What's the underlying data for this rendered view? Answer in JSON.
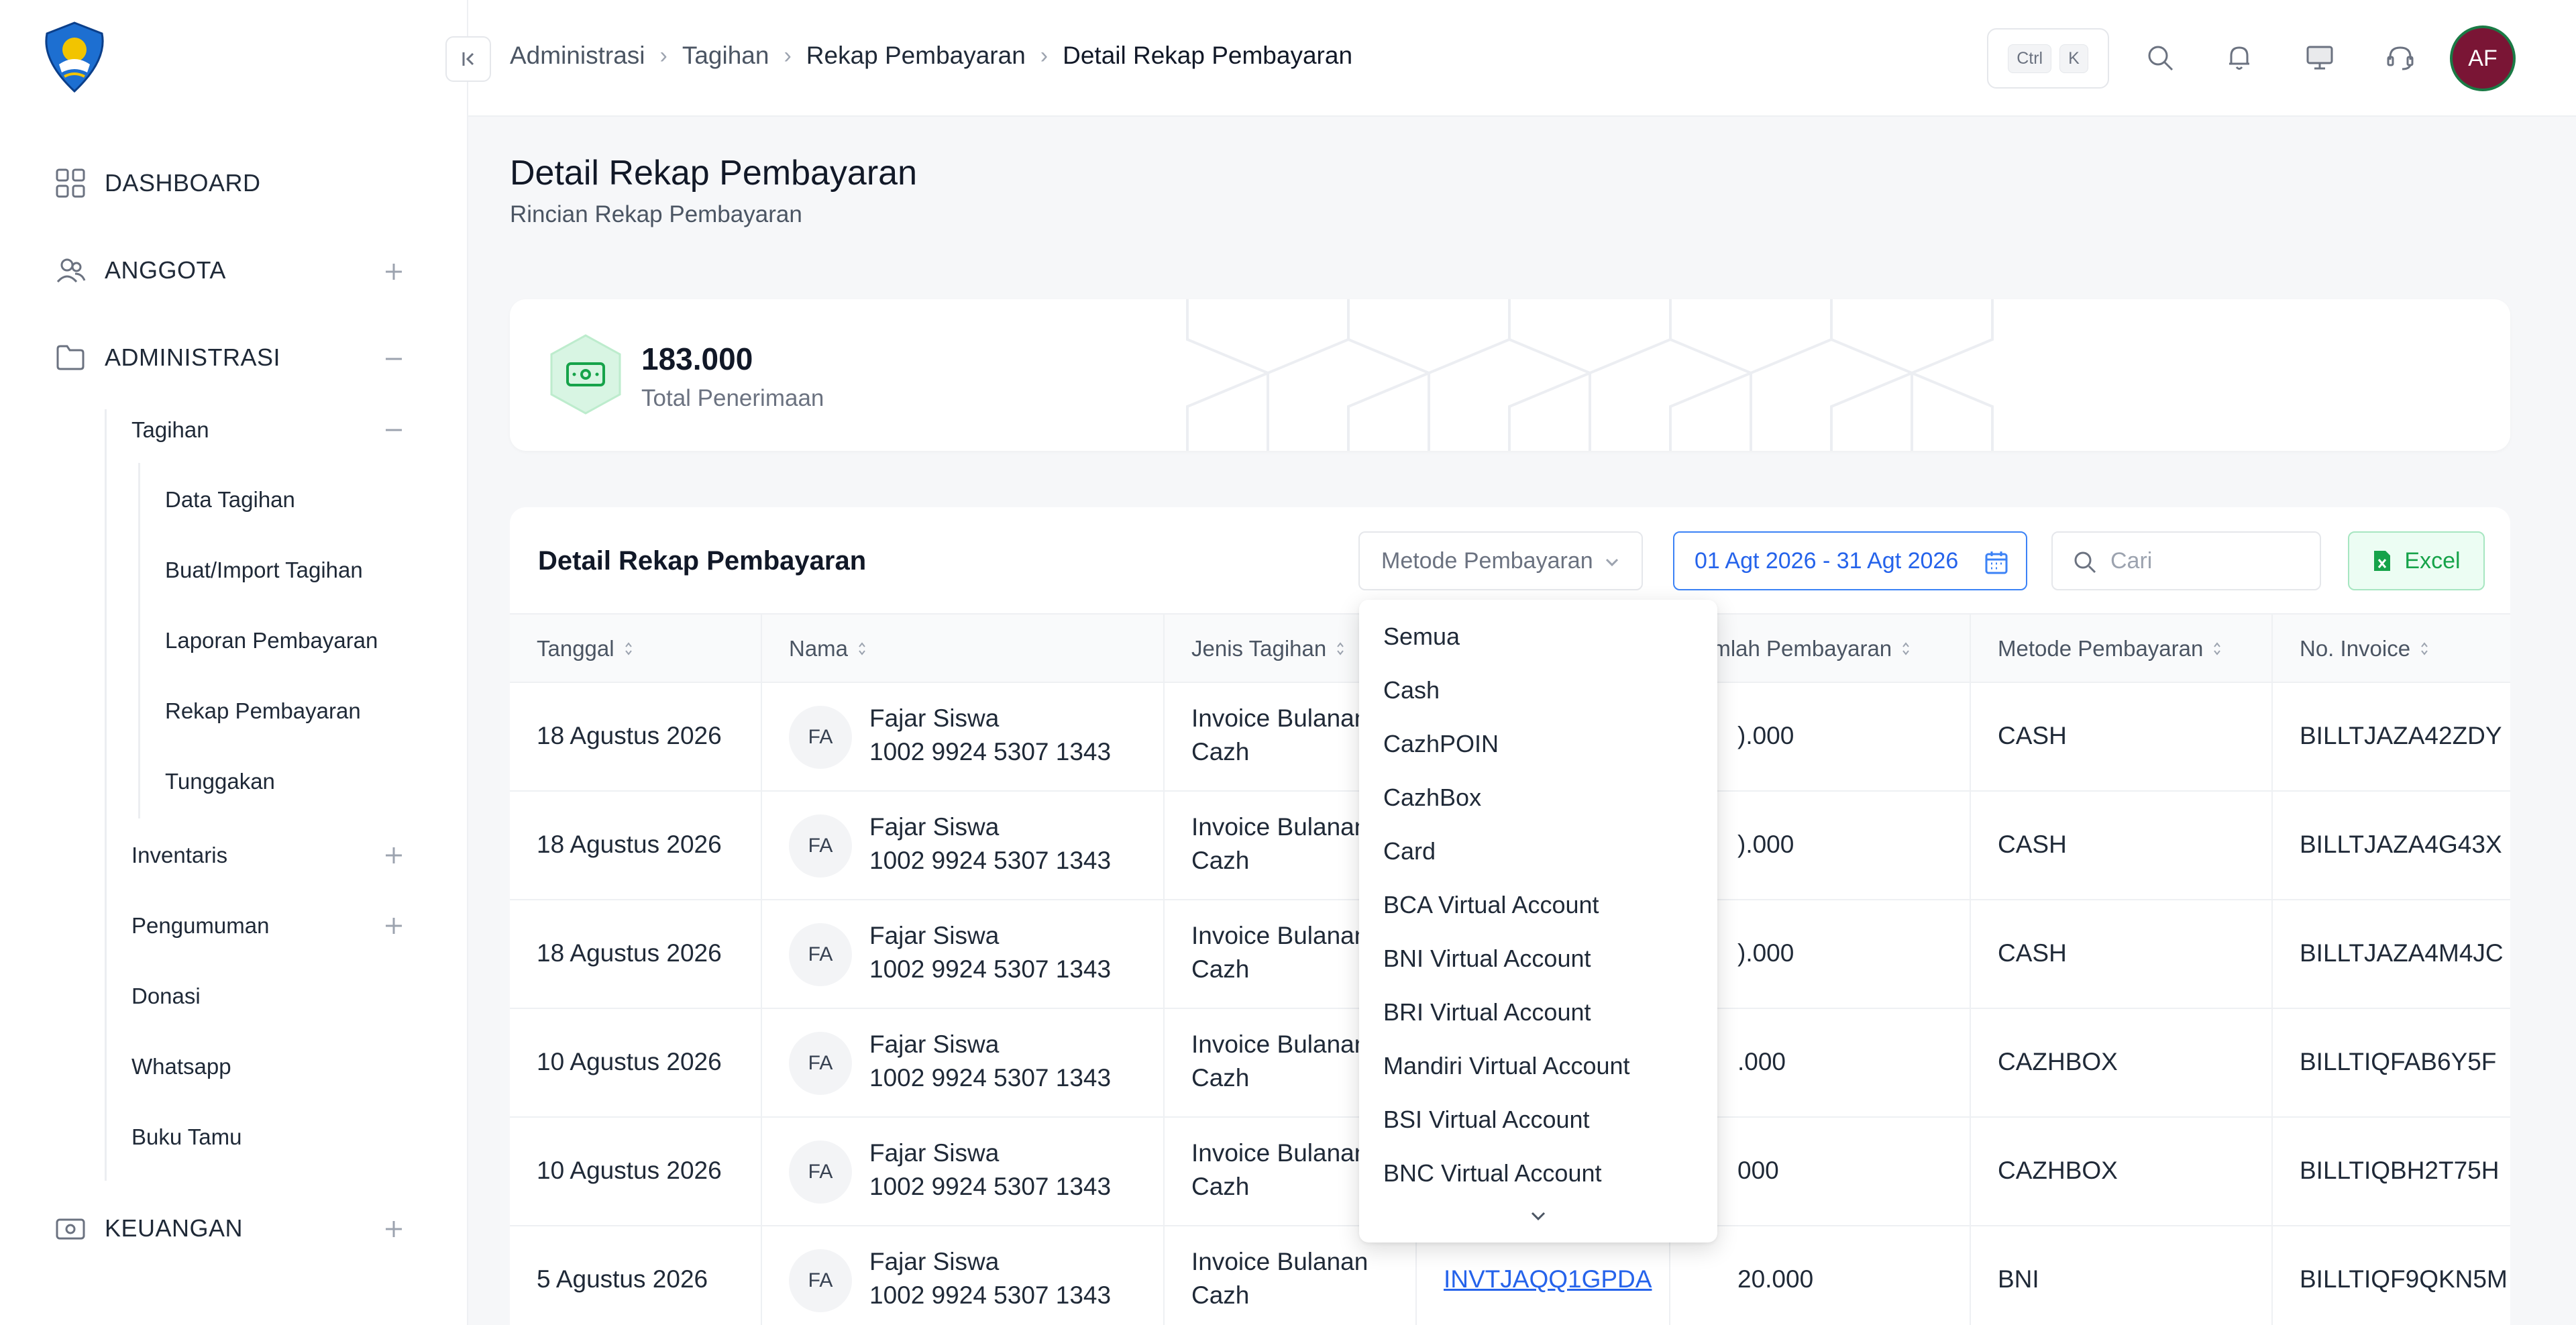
{
  "sidebar": {
    "menu": [
      {
        "label": "DASHBOARD",
        "icon": "grid-icon"
      },
      {
        "label": "ANGGOTA",
        "icon": "users-icon"
      },
      {
        "label": "ADMINISTRASI",
        "icon": "folder-icon"
      },
      {
        "label": "KEUANGAN",
        "icon": "cash-icon"
      }
    ],
    "admin_sub": [
      {
        "label": "Tagihan"
      },
      {
        "label": "Inventaris"
      },
      {
        "label": "Pengumuman"
      },
      {
        "label": "Donasi"
      },
      {
        "label": "Whatsapp"
      },
      {
        "label": "Buku Tamu"
      }
    ],
    "tagihan_sub": [
      {
        "label": "Data Tagihan"
      },
      {
        "label": "Buat/Import Tagihan"
      },
      {
        "label": "Laporan Pembayaran"
      },
      {
        "label": "Rekap Pembayaran"
      },
      {
        "label": "Tunggakan"
      }
    ]
  },
  "breadcrumb": [
    "Administrasi",
    "Tagihan",
    "Rekap Pembayaran",
    "Detail Rekap Pembayaran"
  ],
  "topbar": {
    "kbd_ctrl": "Ctrl",
    "kbd_k": "K",
    "avatar_initials": "AF"
  },
  "page": {
    "title": "Detail Rekap Pembayaran",
    "subtitle": "Rincian Rekap Pembayaran"
  },
  "summary": {
    "value": "183.000",
    "label": "Total Penerimaan"
  },
  "table": {
    "title": "Detail Rekap Pembayaran",
    "filter_placeholder": "Metode Pembayaran",
    "date_range": "01 Agt 2026 - 31 Agt 2026",
    "search_placeholder": "Cari",
    "excel_label": "Excel",
    "headers": [
      "Tanggal",
      "Nama",
      "Jenis Tagihan",
      "umlah Pembayaran",
      "Metode Pembayaran",
      "No. Invoice"
    ],
    "rows": [
      {
        "date": "18 Agustus 2026",
        "initials": "FA",
        "name": "Fajar Siswa",
        "number": "1002 9924 5307 1343",
        "jenis1": "Invoice Bulanan",
        "jenis2": "Cazh",
        "invoice_link": "",
        "amount": ").000",
        "method": "CASH",
        "invoice": "BILLTJAZA42ZDY"
      },
      {
        "date": "18 Agustus 2026",
        "initials": "FA",
        "name": "Fajar Siswa",
        "number": "1002 9924 5307 1343",
        "jenis1": "Invoice Bulanan",
        "jenis2": "Cazh",
        "invoice_link": "",
        "amount": ").000",
        "method": "CASH",
        "invoice": "BILLTJAZA4G43X"
      },
      {
        "date": "18 Agustus 2026",
        "initials": "FA",
        "name": "Fajar Siswa",
        "number": "1002 9924 5307 1343",
        "jenis1": "Invoice Bulanan",
        "jenis2": "Cazh",
        "invoice_link": "",
        "amount": ").000",
        "method": "CASH",
        "invoice": "BILLTJAZA4M4JC"
      },
      {
        "date": "10 Agustus 2026",
        "initials": "FA",
        "name": "Fajar Siswa",
        "number": "1002 9924 5307 1343",
        "jenis1": "Invoice Bulanan",
        "jenis2": "Cazh",
        "invoice_link": "",
        "amount": ".000",
        "method": "CAZHBOX",
        "invoice": "BILLTIQFAB6Y5F"
      },
      {
        "date": "10 Agustus 2026",
        "initials": "FA",
        "name": "Fajar Siswa",
        "number": "1002 9924 5307 1343",
        "jenis1": "Invoice Bulanan",
        "jenis2": "Cazh",
        "invoice_link": "",
        "amount": "000",
        "method": "CAZHBOX",
        "invoice": "BILLTIQBH2T75H"
      },
      {
        "date": "5 Agustus 2026",
        "initials": "FA",
        "name": "Fajar Siswa",
        "number": "1002 9924 5307 1343",
        "jenis1": "Invoice Bulanan",
        "jenis2": "Cazh",
        "invoice_link": "INVTJAQQ1GPDA",
        "amount": "20.000",
        "method": "BNI",
        "invoice": "BILLTIQF9QKN5M"
      }
    ]
  },
  "dropdown": {
    "options": [
      "Semua",
      "Cash",
      "CazhPOIN",
      "CazhBox",
      "Card",
      "BCA Virtual Account",
      "BNI Virtual Account",
      "BRI Virtual Account",
      "Mandiri Virtual Account",
      "BSI Virtual Account",
      "BNC Virtual Account"
    ]
  },
  "colors": {
    "accent": "#2563eb",
    "excel": "#16a34a",
    "avatar": "#7a1535"
  }
}
